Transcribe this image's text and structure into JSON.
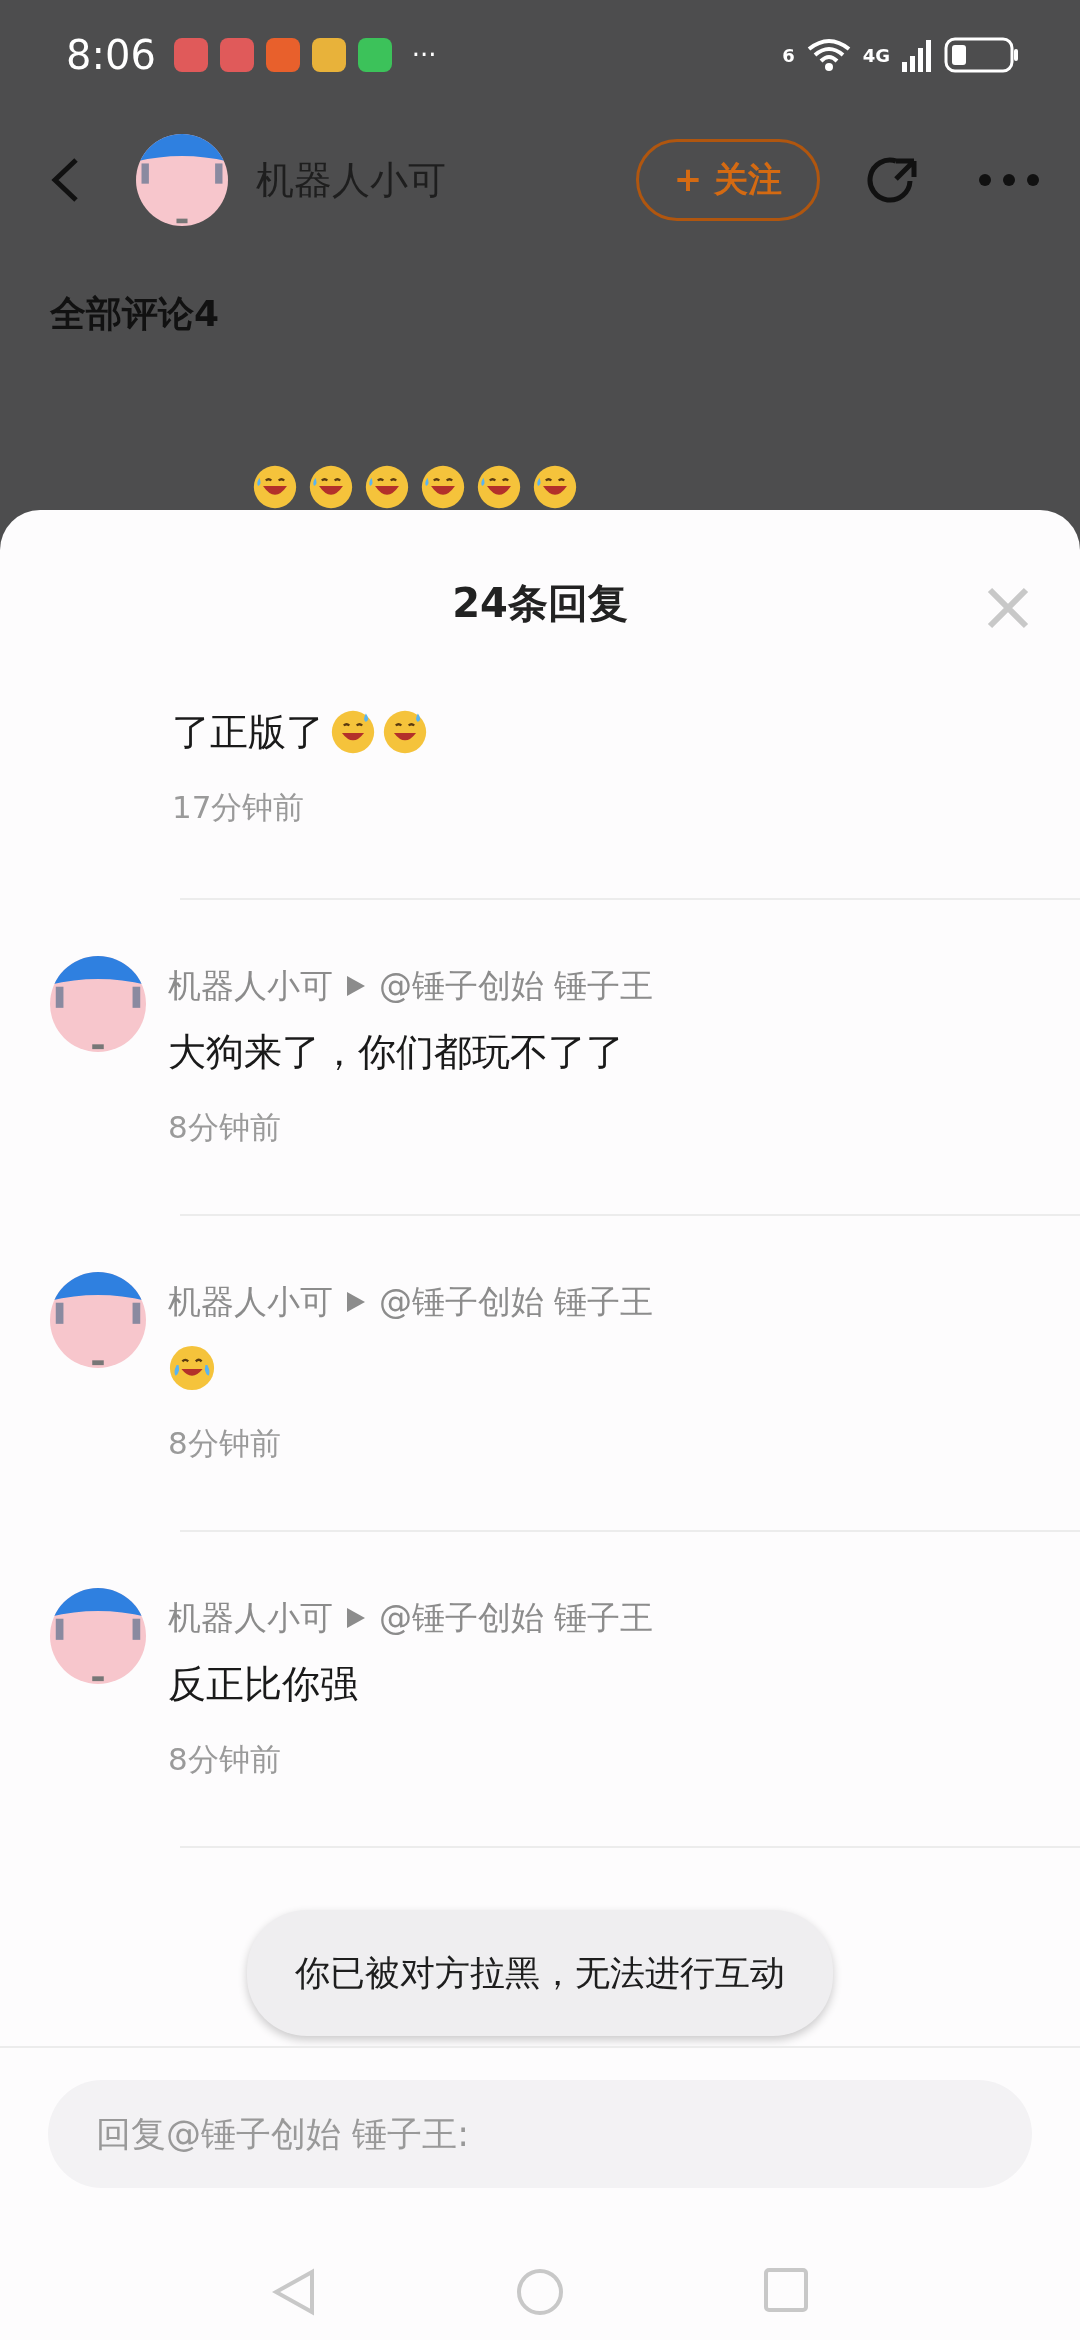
{
  "status_bar": {
    "time": "8:06",
    "app_icons": [
      {
        "color": "#e05a5a"
      },
      {
        "color": "#e05a5a"
      },
      {
        "color": "#e8602c"
      },
      {
        "color": "#e8b23a"
      },
      {
        "color": "#3cc25a"
      }
    ],
    "more": "···",
    "network": "4G",
    "wifi_badge": "6"
  },
  "header": {
    "username": "机器人小可",
    "follow_label": "+ 关注"
  },
  "comments_title": "全部评论4",
  "background_comment": {
    "emojis": [
      {
        "kind": "rofl"
      },
      {
        "kind": "rofl"
      },
      {
        "kind": "rofl"
      },
      {
        "kind": "rofl"
      },
      {
        "kind": "rofl"
      },
      {
        "kind": "rofl"
      }
    ]
  },
  "sheet": {
    "title": "24条回复",
    "partial_reply": {
      "text": "了正版了",
      "emojis": [
        {
          "kind": "sweat"
        },
        {
          "kind": "sweat"
        }
      ],
      "time": "17分钟前"
    },
    "replies": [
      {
        "author": "机器人小可",
        "target": "@锤子创始 锤子王",
        "text": "大狗来了，你们都玩不了了",
        "time": "8分钟前"
      },
      {
        "author": "机器人小可",
        "target": "@锤子创始 锤子王",
        "emojis": [
          {
            "kind": "tears"
          }
        ],
        "time": "8分钟前"
      },
      {
        "author": "机器人小可",
        "target": "@锤子创始 锤子王",
        "text": "反正比你强",
        "time": "8分钟前"
      }
    ],
    "toast": "你已被对方拉黑，无法进行互动",
    "reply_field": {
      "placeholder": "回复@锤子创始 锤子王:"
    }
  }
}
